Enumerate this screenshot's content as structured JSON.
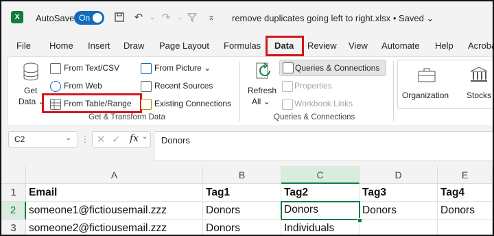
{
  "titlebar": {
    "autosave_label": "AutoSave",
    "toggle_label": "On",
    "filename": "remove duplicates going left to right.xlsx • Saved ⌄"
  },
  "tabs": [
    "File",
    "Home",
    "Insert",
    "Draw",
    "Page Layout",
    "Formulas",
    "Data",
    "Review",
    "View",
    "Automate",
    "Help",
    "Acroba"
  ],
  "active_tab": "Data",
  "ribbon": {
    "get_data": [
      "Get",
      "Data ⌄"
    ],
    "from_text_csv": "From Text/CSV",
    "from_web": "From Web",
    "from_table_range": "From Table/Range",
    "from_picture": "From Picture ⌄",
    "recent_sources": "Recent Sources",
    "existing_connections": "Existing Connections",
    "group1_label": "Get & Transform Data",
    "refresh_all": [
      "Refresh",
      "All ⌄"
    ],
    "queries_connections": "Queries & Connections",
    "properties": "Properties",
    "workbook_links": "Workbook Links",
    "group2_label": "Queries & Connections",
    "organization": "Organization",
    "stocks": "Stocks"
  },
  "formula_bar": {
    "name_box": "C2",
    "fx": "fx",
    "content": "Donors"
  },
  "sheet": {
    "columns": [
      "A",
      "B",
      "C",
      "D",
      "E"
    ],
    "rows": [
      "1",
      "2",
      "3"
    ],
    "cells": [
      [
        "Email",
        "Tag1",
        "Tag2",
        "Tag3",
        "Tag4"
      ],
      [
        "someone1@fictiousemail.zzz",
        "Donors",
        "Donors",
        "Donors",
        "Donors"
      ],
      [
        "someone2@fictiousemail.zzz",
        "Donors",
        "Individuals",
        "",
        ""
      ]
    ],
    "active_cell": "C2"
  },
  "colors": {
    "excel_green": "#107c41",
    "highlight_red": "#d4161c",
    "toggle_blue": "#0f6cbd"
  }
}
